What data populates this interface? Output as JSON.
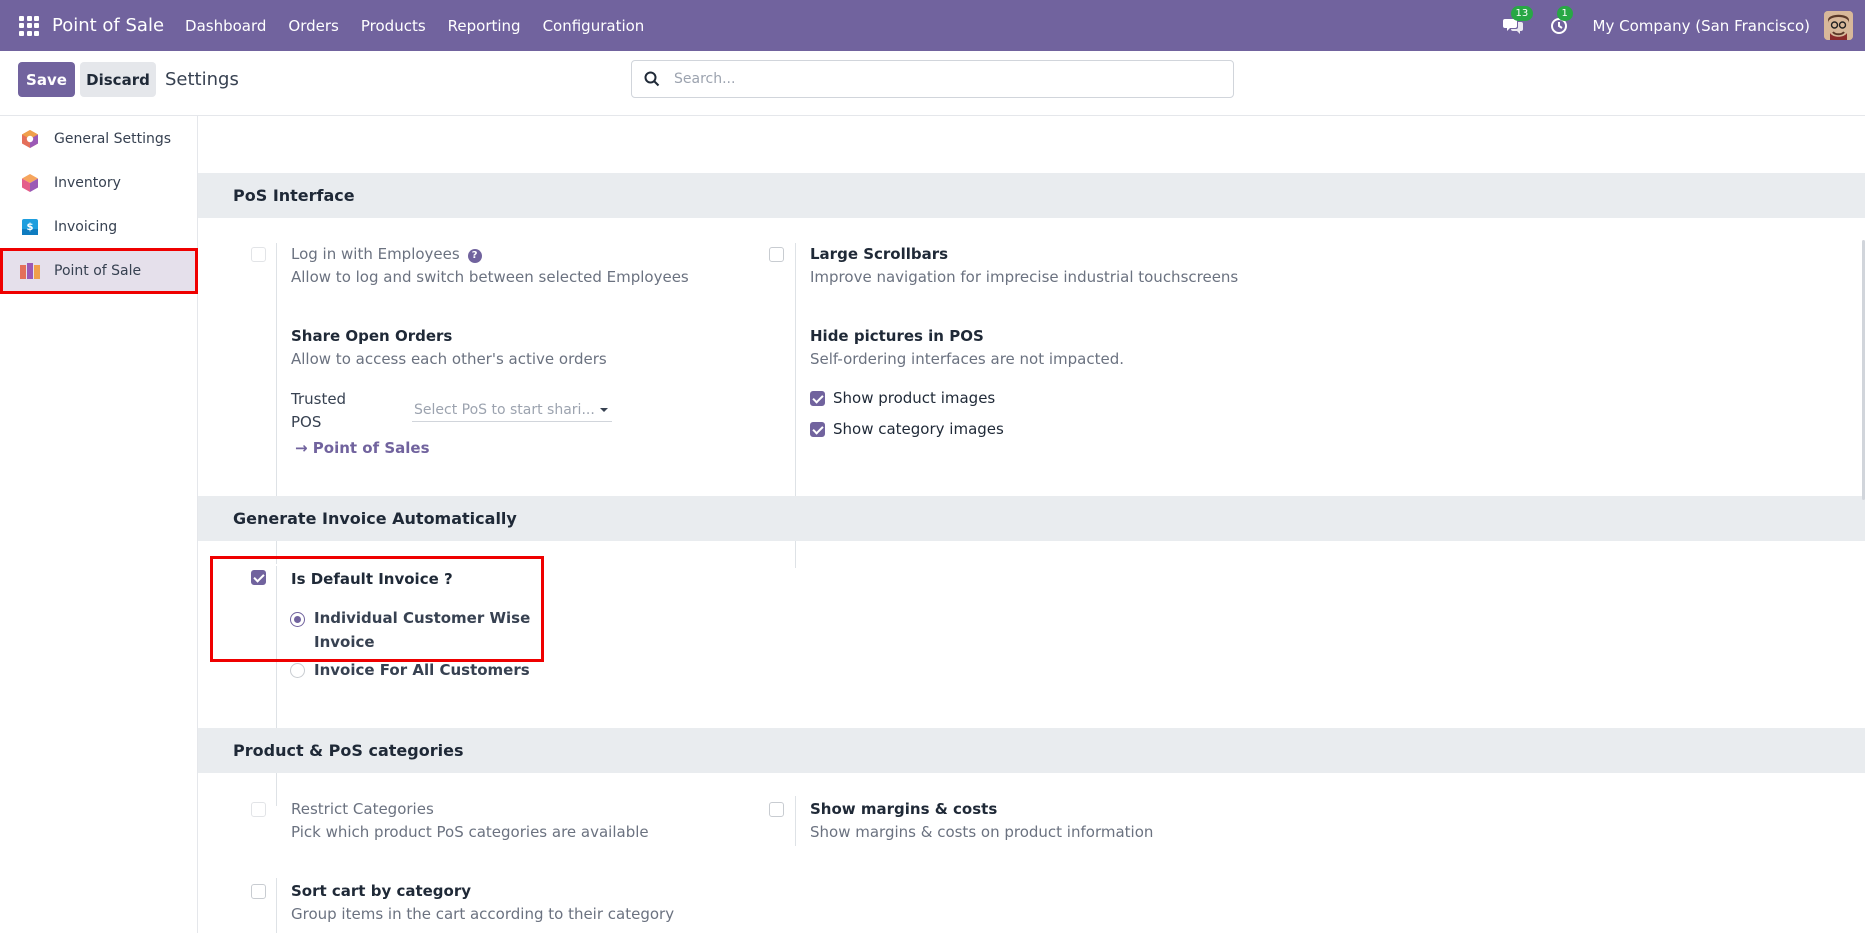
{
  "navbar": {
    "brand": "Point of Sale",
    "menu": [
      "Dashboard",
      "Orders",
      "Products",
      "Reporting",
      "Configuration"
    ],
    "messages_badge": "13",
    "activity_badge": "1",
    "company": "My Company (San Francisco)"
  },
  "control": {
    "save_label": "Save",
    "discard_label": "Discard",
    "title": "Settings",
    "search_placeholder": "Search..."
  },
  "sidebar": {
    "items": [
      {
        "label": "General Settings",
        "icon": "general-settings-icon"
      },
      {
        "label": "Inventory",
        "icon": "inventory-icon"
      },
      {
        "label": "Invoicing",
        "icon": "invoicing-icon"
      },
      {
        "label": "Point of Sale",
        "icon": "point-of-sale-icon",
        "active": true
      }
    ]
  },
  "sections": {
    "pos_interface": {
      "title": "PoS Interface",
      "login_employees": {
        "title": "Log in with Employees",
        "desc": "Allow to log and switch between selected Employees",
        "checked": false,
        "disabled": true
      },
      "large_scrollbars": {
        "title": "Large Scrollbars",
        "desc": "Improve navigation for imprecise industrial touchscreens",
        "checked": false
      },
      "share_orders": {
        "title": "Share Open Orders",
        "desc": "Allow to access each other's active orders",
        "trusted_label_1": "Trusted",
        "trusted_label_2": "POS",
        "trusted_placeholder": "Select PoS to start shari...",
        "link": "Point of Sales"
      },
      "hide_pictures": {
        "title": "Hide pictures in POS",
        "desc": "Self-ordering interfaces are not impacted.",
        "show_product_images": "Show product images",
        "show_category_images": "Show category images"
      }
    },
    "generate_invoice": {
      "title": "Generate Invoice Automatically",
      "default_invoice": {
        "title": "Is Default Invoice ?",
        "checked": true
      },
      "options": [
        "Individual Customer Wise",
        "Invoice",
        "Invoice For All Customers"
      ],
      "selected_option": "Individual Customer Wise Invoice"
    },
    "product_categories": {
      "title": "Product & PoS categories",
      "restrict": {
        "title": "Restrict Categories",
        "desc": "Pick which product PoS categories are available",
        "disabled": true
      },
      "margins": {
        "title": "Show margins & costs",
        "desc": "Show margins & costs on product information"
      },
      "sort_cart": {
        "title": "Sort cart by category",
        "desc": "Group items in the cart according to their category"
      }
    }
  },
  "colors": {
    "brand": "#71639e",
    "highlight": "#ef0000",
    "badge": "#28a745"
  }
}
